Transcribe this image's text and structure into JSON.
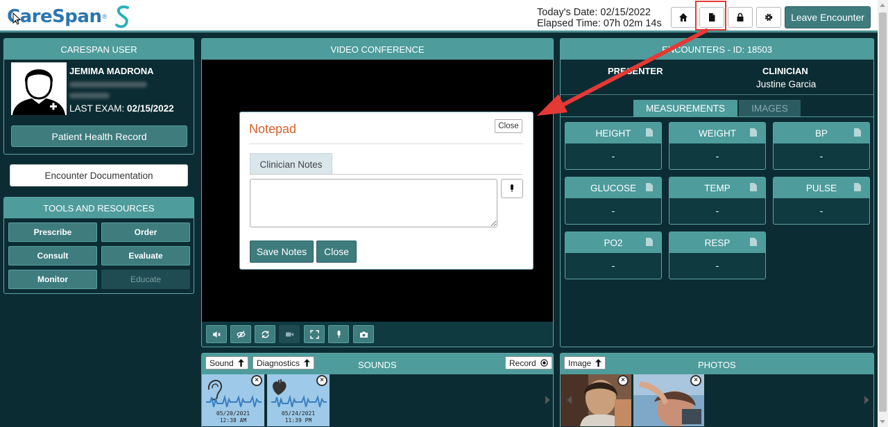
{
  "header": {
    "logo_text": "CareSpan",
    "logo_tm": "®",
    "date_line": "Today's Date: 02/15/2022",
    "elapsed_line": "Elapsed Time: 07h 02m 14s",
    "leave_label": "Leave Encounter"
  },
  "user_panel": {
    "title": "CARESPAN USER",
    "name": "JEMIMA MADRONA",
    "last_exam_label": "LAST EXAM:",
    "last_exam_date": "02/15/2022",
    "phr_label": "Patient Health Record"
  },
  "encounter_doc_label": "Encounter Documentation",
  "tools": {
    "title": "TOOLS AND RESOURCES",
    "buttons": [
      "Prescribe",
      "Order",
      "Consult",
      "Evaluate",
      "Monitor",
      "Educate"
    ]
  },
  "video": {
    "title": "VIDEO CONFERENCE"
  },
  "notepad": {
    "title": "Notepad",
    "close_small": "Close",
    "tab": "Clinician Notes",
    "textarea_value": "",
    "save_label": "Save Notes",
    "close_label": "Close"
  },
  "encounters": {
    "title": "ENCOUNTERS - ID: 18503",
    "presenter_label": "PRESENTER",
    "clinician_label": "CLINICIAN",
    "clinician_name": "Justine Garcia",
    "tabs": [
      "MEASUREMENTS",
      "IMAGES"
    ],
    "measurements": [
      {
        "name": "HEIGHT",
        "value": "-"
      },
      {
        "name": "WEIGHT",
        "value": "-"
      },
      {
        "name": "BP",
        "value": "-"
      },
      {
        "name": "GLUCOSE",
        "value": "-"
      },
      {
        "name": "TEMP",
        "value": "-"
      },
      {
        "name": "PULSE",
        "value": "-"
      },
      {
        "name": "PO2",
        "value": "-"
      },
      {
        "name": "RESP",
        "value": "-"
      }
    ]
  },
  "sounds": {
    "title": "SOUNDS",
    "sound_btn": "Sound",
    "diagnostics_btn": "Diagnostics",
    "record_btn": "Record",
    "items": [
      {
        "date": "05/20/2021",
        "time": "12:38 AM",
        "icon": "ear-icon"
      },
      {
        "date": "05/24/2021",
        "time": "11:39 PM",
        "icon": "heart-icon"
      }
    ]
  },
  "photos": {
    "title": "PHOTOS",
    "image_btn": "Image"
  },
  "colors": {
    "teal": "#4e9c9c",
    "dark_bg": "#0c2c33",
    "title_orange": "#d5622d",
    "highlight_red": "#e53935"
  }
}
